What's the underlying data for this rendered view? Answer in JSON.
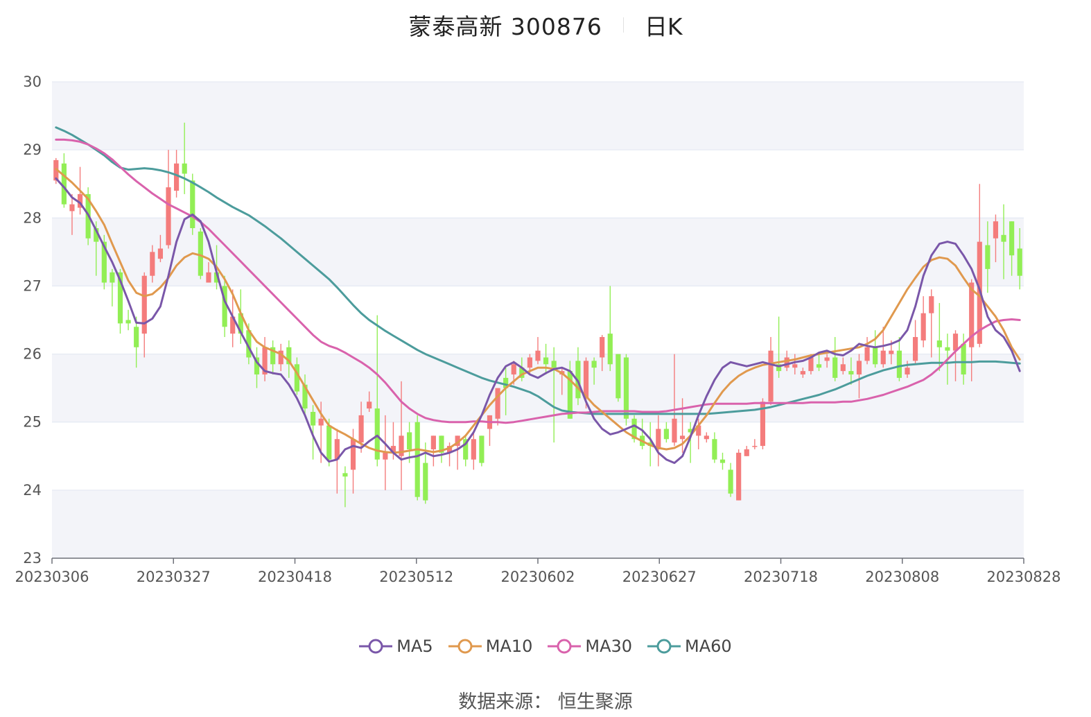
{
  "header": {
    "title": "蒙泰高新 300876",
    "period": "日K"
  },
  "source_text": "数据来源：  恒生聚源",
  "colors": {
    "up": "#f47c7c",
    "down": "#92ee55",
    "ma5": "#7a57a9",
    "ma10": "#e0994e",
    "ma30": "#d962ac",
    "ma60": "#4c9c9c"
  },
  "chart_data": {
    "type": "candlestick",
    "ylim": [
      23,
      30
    ],
    "yticks": [
      23,
      24,
      25,
      26,
      27,
      28,
      29,
      30
    ],
    "xticks": [
      "20230306",
      "20230327",
      "20230418",
      "20230512",
      "20230602",
      "20230627",
      "20230718",
      "20230808",
      "20230828"
    ],
    "legend": [
      "MA5",
      "MA10",
      "MA30",
      "MA60"
    ],
    "x_count": 121,
    "candles": [
      [
        28.55,
        28.85,
        28.88,
        28.5
      ],
      [
        28.8,
        28.2,
        28.95,
        28.15
      ],
      [
        28.1,
        28.2,
        28.35,
        27.75
      ],
      [
        28.15,
        28.35,
        28.75,
        28.05
      ],
      [
        28.35,
        27.7,
        28.45,
        27.6
      ],
      [
        27.85,
        27.65,
        27.95,
        27.15
      ],
      [
        27.65,
        27.05,
        27.75,
        26.95
      ],
      [
        27.2,
        27.05,
        27.25,
        26.7
      ],
      [
        27.2,
        26.45,
        27.25,
        26.3
      ],
      [
        26.5,
        26.45,
        26.65,
        26.35
      ],
      [
        26.4,
        26.1,
        26.55,
        25.8
      ],
      [
        26.3,
        27.15,
        27.2,
        25.95
      ],
      [
        27.15,
        27.5,
        27.6,
        27.05
      ],
      [
        27.4,
        27.55,
        27.75,
        27.35
      ],
      [
        27.6,
        28.45,
        29.0,
        27.55
      ],
      [
        28.4,
        28.8,
        29.0,
        28.3
      ],
      [
        28.8,
        28.65,
        29.4,
        28.35
      ],
      [
        28.55,
        27.85,
        28.65,
        27.75
      ],
      [
        27.8,
        27.15,
        27.85,
        27.1
      ],
      [
        27.05,
        27.2,
        27.35,
        27.05
      ],
      [
        27.2,
        27.05,
        27.6,
        26.95
      ],
      [
        27.0,
        26.4,
        27.15,
        26.25
      ],
      [
        26.3,
        26.55,
        26.95,
        26.1
      ],
      [
        26.6,
        26.3,
        26.95,
        26.15
      ],
      [
        26.35,
        25.95,
        26.45,
        25.85
      ],
      [
        25.95,
        25.7,
        26.1,
        25.5
      ],
      [
        25.7,
        26.1,
        26.25,
        25.6
      ],
      [
        26.1,
        25.85,
        26.2,
        25.7
      ],
      [
        25.85,
        26.05,
        26.15,
        25.75
      ],
      [
        26.1,
        25.85,
        26.2,
        25.65
      ],
      [
        25.85,
        25.45,
        25.95,
        25.4
      ],
      [
        25.55,
        25.2,
        25.7,
        25.1
      ],
      [
        25.15,
        24.95,
        25.25,
        24.45
      ],
      [
        24.95,
        25.05,
        25.3,
        24.4
      ],
      [
        24.95,
        24.45,
        25.05,
        24.35
      ],
      [
        24.45,
        24.75,
        24.9,
        23.95
      ],
      [
        24.25,
        24.2,
        24.35,
        23.75
      ],
      [
        24.3,
        24.75,
        24.9,
        23.95
      ],
      [
        24.7,
        25.1,
        25.3,
        24.55
      ],
      [
        25.2,
        25.3,
        25.45,
        25.15
      ],
      [
        25.2,
        24.45,
        26.57,
        24.35
      ],
      [
        24.45,
        24.55,
        25.1,
        24.0
      ],
      [
        24.55,
        24.65,
        25.0,
        24.45
      ],
      [
        24.5,
        24.8,
        25.6,
        24.0
      ],
      [
        24.85,
        24.6,
        25.0,
        24.4
      ],
      [
        25.0,
        23.9,
        25.1,
        23.85
      ],
      [
        24.4,
        23.85,
        24.7,
        23.8
      ],
      [
        24.6,
        24.8,
        24.8,
        24.35
      ],
      [
        24.8,
        24.55,
        24.8,
        24.4
      ],
      [
        24.55,
        24.65,
        24.7,
        24.35
      ],
      [
        24.65,
        24.8,
        24.8,
        24.3
      ],
      [
        24.75,
        24.45,
        24.8,
        24.35
      ],
      [
        24.45,
        24.75,
        24.85,
        24.3
      ],
      [
        24.8,
        24.4,
        24.8,
        24.35
      ],
      [
        24.9,
        25.1,
        25.1,
        24.65
      ],
      [
        25.05,
        25.5,
        25.5,
        24.95
      ],
      [
        25.65,
        25.5,
        25.8,
        25.1
      ],
      [
        25.7,
        25.85,
        25.9,
        25.55
      ],
      [
        25.8,
        25.65,
        25.95,
        25.6
      ],
      [
        25.8,
        25.95,
        26.0,
        25.7
      ],
      [
        25.9,
        26.05,
        26.25,
        25.85
      ],
      [
        25.95,
        25.85,
        26.15,
        25.7
      ],
      [
        25.9,
        25.8,
        26.1,
        24.7
      ],
      [
        25.7,
        25.75,
        25.8,
        25.4
      ],
      [
        25.75,
        25.05,
        25.9,
        25.05
      ],
      [
        25.9,
        25.35,
        26.1,
        25.25
      ],
      [
        25.35,
        25.9,
        25.95,
        25.2
      ],
      [
        25.9,
        25.8,
        25.95,
        25.55
      ],
      [
        25.95,
        26.25,
        26.28,
        25.75
      ],
      [
        26.3,
        25.85,
        27.0,
        25.75
      ],
      [
        26.0,
        25.35,
        26.0,
        25.3
      ],
      [
        25.95,
        25.05,
        26.0,
        24.95
      ],
      [
        25.05,
        24.75,
        25.1,
        24.7
      ],
      [
        24.8,
        24.65,
        25.05,
        24.6
      ],
      [
        24.7,
        24.65,
        25.0,
        24.35
      ],
      [
        24.6,
        24.9,
        25.1,
        24.35
      ],
      [
        24.9,
        24.75,
        25.0,
        24.7
      ],
      [
        24.7,
        25.05,
        26.0,
        24.65
      ],
      [
        24.75,
        24.8,
        25.35,
        24.55
      ],
      [
        24.9,
        24.85,
        25.0,
        24.4
      ],
      [
        24.8,
        24.95,
        25.05,
        24.6
      ],
      [
        24.75,
        24.8,
        24.85,
        24.7
      ],
      [
        24.75,
        24.45,
        24.85,
        24.4
      ],
      [
        24.45,
        24.4,
        24.55,
        24.3
      ],
      [
        24.3,
        23.95,
        24.4,
        23.9
      ],
      [
        23.85,
        24.55,
        24.6,
        23.85
      ],
      [
        24.5,
        24.6,
        24.65,
        24.5
      ],
      [
        24.65,
        24.65,
        24.75,
        24.6
      ],
      [
        24.65,
        25.3,
        25.35,
        24.6
      ],
      [
        25.3,
        26.05,
        26.25,
        25.25
      ],
      [
        25.85,
        25.75,
        26.55,
        25.65
      ],
      [
        25.8,
        25.95,
        26.05,
        25.75
      ],
      [
        25.8,
        25.85,
        26.0,
        25.7
      ],
      [
        25.7,
        25.75,
        25.8,
        25.65
      ],
      [
        25.75,
        25.95,
        26.0,
        25.7
      ],
      [
        25.85,
        25.8,
        26.0,
        25.75
      ],
      [
        25.9,
        25.95,
        26.0,
        25.8
      ],
      [
        25.95,
        25.65,
        26.25,
        25.6
      ],
      [
        25.75,
        25.85,
        25.95,
        25.7
      ],
      [
        25.75,
        25.7,
        25.95,
        25.55
      ],
      [
        25.7,
        25.9,
        26.0,
        25.35
      ],
      [
        25.9,
        26.1,
        26.25,
        25.85
      ],
      [
        26.1,
        25.85,
        26.35,
        25.8
      ],
      [
        25.85,
        26.05,
        26.4,
        25.8
      ],
      [
        26.0,
        26.05,
        26.2,
        25.85
      ],
      [
        26.05,
        25.65,
        26.25,
        25.6
      ],
      [
        25.7,
        25.8,
        25.9,
        25.65
      ],
      [
        25.9,
        26.25,
        26.5,
        25.85
      ],
      [
        26.2,
        26.6,
        26.85,
        26.1
      ],
      [
        26.6,
        26.85,
        26.95,
        25.95
      ],
      [
        26.2,
        26.1,
        26.75,
        25.75
      ],
      [
        26.1,
        26.05,
        26.3,
        25.55
      ],
      [
        26.05,
        26.3,
        26.35,
        25.6
      ],
      [
        26.15,
        25.7,
        26.3,
        25.55
      ],
      [
        26.1,
        27.05,
        27.1,
        25.6
      ],
      [
        26.15,
        27.65,
        28.5,
        26.1
      ],
      [
        27.6,
        27.25,
        27.95,
        26.9
      ],
      [
        27.7,
        27.95,
        28.05,
        27.35
      ],
      [
        27.75,
        27.65,
        28.2,
        27.1
      ],
      [
        27.95,
        27.45,
        27.95,
        27.15
      ],
      [
        27.55,
        27.15,
        27.85,
        26.95
      ]
    ],
    "ma5": [
      28.58,
      28.45,
      28.3,
      28.22,
      28.05,
      27.82,
      27.58,
      27.35,
      27.08,
      26.78,
      26.46,
      26.45,
      26.52,
      26.7,
      27.15,
      27.65,
      27.98,
      28.05,
      27.95,
      27.65,
      27.2,
      26.78,
      26.55,
      26.32,
      26.1,
      25.88,
      25.75,
      25.72,
      25.7,
      25.55,
      25.35,
      25.1,
      24.8,
      24.55,
      24.42,
      24.45,
      24.6,
      24.65,
      24.62,
      24.72,
      24.8,
      24.68,
      24.55,
      24.45,
      24.48,
      24.5,
      24.55,
      24.5,
      24.52,
      24.55,
      24.6,
      24.68,
      24.85,
      25.1,
      25.4,
      25.65,
      25.82,
      25.88,
      25.8,
      25.7,
      25.65,
      25.72,
      25.78,
      25.8,
      25.75,
      25.6,
      25.3,
      25.05,
      24.9,
      24.82,
      24.85,
      24.9,
      24.95,
      24.88,
      24.75,
      24.55,
      24.45,
      24.4,
      24.5,
      24.78,
      25.1,
      25.38,
      25.62,
      25.8,
      25.88,
      25.85,
      25.82,
      25.85,
      25.88,
      25.85,
      25.82,
      25.85,
      25.88,
      25.9,
      25.95,
      26.02,
      26.05,
      26.0,
      25.98,
      26.05,
      26.15,
      26.12,
      26.1,
      26.12,
      26.15,
      26.2,
      26.35,
      26.7,
      27.15,
      27.45,
      27.62,
      27.65,
      27.62,
      27.45,
      27.25,
      26.95,
      26.55,
      26.35,
      26.25,
      26.05,
      25.75
    ],
    "ma10": [
      28.72,
      28.62,
      28.52,
      28.4,
      28.28,
      28.1,
      27.9,
      27.62,
      27.35,
      27.08,
      26.9,
      26.85,
      26.88,
      26.98,
      27.12,
      27.3,
      27.42,
      27.48,
      27.45,
      27.4,
      27.28,
      27.1,
      26.88,
      26.6,
      26.35,
      26.18,
      26.1,
      26.05,
      26.0,
      25.9,
      25.72,
      25.52,
      25.32,
      25.12,
      24.95,
      24.88,
      24.82,
      24.75,
      24.68,
      24.62,
      24.58,
      24.56,
      24.55,
      24.56,
      24.58,
      24.6,
      24.58,
      24.56,
      24.58,
      24.62,
      24.7,
      24.8,
      24.95,
      25.1,
      25.25,
      25.38,
      25.5,
      25.6,
      25.7,
      25.75,
      25.8,
      25.8,
      25.78,
      25.72,
      25.62,
      25.5,
      25.38,
      25.25,
      25.15,
      25.05,
      24.95,
      24.85,
      24.78,
      24.72,
      24.66,
      24.62,
      24.6,
      24.62,
      24.68,
      24.8,
      24.95,
      25.1,
      25.28,
      25.45,
      25.58,
      25.68,
      25.75,
      25.8,
      25.84,
      25.86,
      25.88,
      25.9,
      25.92,
      25.95,
      25.98,
      26.0,
      26.02,
      26.04,
      26.06,
      26.08,
      26.1,
      26.15,
      26.22,
      26.35,
      26.55,
      26.75,
      26.95,
      27.12,
      27.28,
      27.38,
      27.42,
      27.4,
      27.3,
      27.12,
      26.95,
      26.85,
      26.7,
      26.55,
      26.35,
      26.1,
      25.92
    ],
    "ma30": [
      29.15,
      29.15,
      29.14,
      29.12,
      29.08,
      29.02,
      28.95,
      28.86,
      28.75,
      28.64,
      28.54,
      28.45,
      28.36,
      28.28,
      28.2,
      28.14,
      28.08,
      28.02,
      27.94,
      27.84,
      27.72,
      27.6,
      27.48,
      27.36,
      27.24,
      27.12,
      27.0,
      26.88,
      26.76,
      26.64,
      26.52,
      26.4,
      26.28,
      26.18,
      26.12,
      26.08,
      26.02,
      25.95,
      25.88,
      25.8,
      25.7,
      25.58,
      25.44,
      25.3,
      25.2,
      25.12,
      25.06,
      25.03,
      25.01,
      25.0,
      25.0,
      25.0,
      25.01,
      25.01,
      25.0,
      25.0,
      24.99,
      25.0,
      25.02,
      25.04,
      25.06,
      25.08,
      25.1,
      25.12,
      25.13,
      25.14,
      25.14,
      25.15,
      25.16,
      25.16,
      25.16,
      25.16,
      25.16,
      25.15,
      25.15,
      25.15,
      25.16,
      25.18,
      25.2,
      25.22,
      25.24,
      25.26,
      25.27,
      25.27,
      25.27,
      25.27,
      25.27,
      25.28,
      25.28,
      25.28,
      25.28,
      25.28,
      25.28,
      25.28,
      25.29,
      25.29,
      25.29,
      25.29,
      25.3,
      25.3,
      25.32,
      25.34,
      25.37,
      25.4,
      25.44,
      25.48,
      25.52,
      25.57,
      25.62,
      25.7,
      25.8,
      25.92,
      26.04,
      26.15,
      26.26,
      26.35,
      26.42,
      26.48,
      26.5,
      26.51,
      26.5
    ],
    "ma60": [
      29.33,
      29.28,
      29.22,
      29.15,
      29.08,
      29.0,
      28.92,
      28.82,
      28.74,
      28.71,
      28.72,
      28.73,
      28.72,
      28.7,
      28.67,
      28.63,
      28.58,
      28.52,
      28.45,
      28.38,
      28.3,
      28.23,
      28.16,
      28.1,
      28.04,
      27.96,
      27.88,
      27.79,
      27.7,
      27.6,
      27.5,
      27.4,
      27.3,
      27.2,
      27.1,
      26.98,
      26.85,
      26.72,
      26.6,
      26.5,
      26.42,
      26.34,
      26.27,
      26.2,
      26.13,
      26.06,
      26.0,
      25.95,
      25.9,
      25.85,
      25.8,
      25.75,
      25.7,
      25.65,
      25.61,
      25.58,
      25.55,
      25.52,
      25.48,
      25.44,
      25.38,
      25.3,
      25.22,
      25.17,
      25.15,
      25.14,
      25.13,
      25.12,
      25.12,
      25.12,
      25.12,
      25.12,
      25.12,
      25.12,
      25.12,
      25.12,
      25.12,
      25.12,
      25.12,
      25.12,
      25.12,
      25.12,
      25.13,
      25.14,
      25.15,
      25.16,
      25.17,
      25.18,
      25.2,
      25.22,
      25.25,
      25.28,
      25.31,
      25.34,
      25.37,
      25.4,
      25.44,
      25.48,
      25.53,
      25.58,
      25.63,
      25.68,
      25.72,
      25.76,
      25.79,
      25.82,
      25.84,
      25.85,
      25.86,
      25.87,
      25.87,
      25.87,
      25.88,
      25.88,
      25.88,
      25.89,
      25.89,
      25.89,
      25.88,
      25.87,
      25.86
    ]
  }
}
